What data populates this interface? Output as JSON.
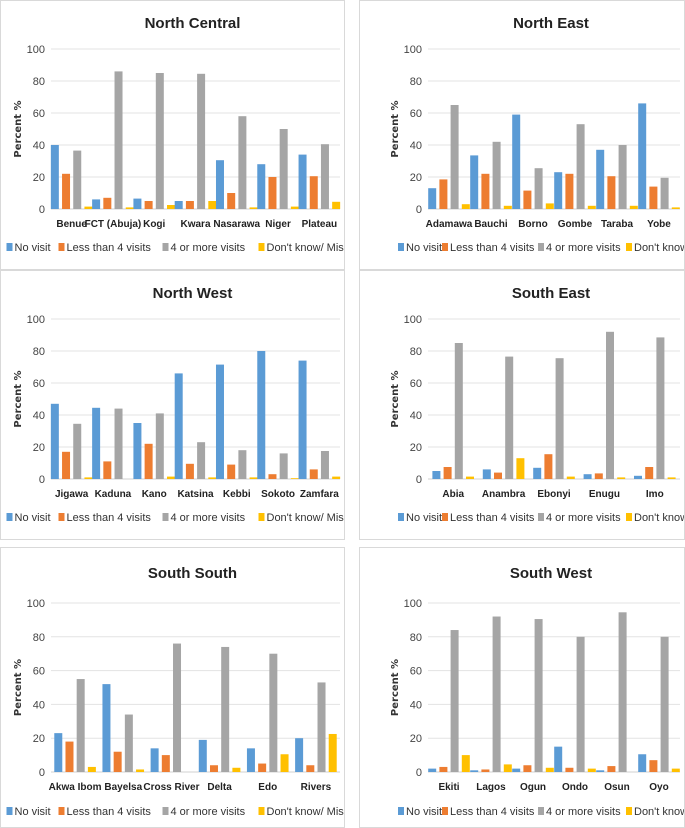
{
  "chart_data": [
    {
      "type": "bar",
      "title": "North Central",
      "xlabel": "",
      "ylabel": "Percent %",
      "ylim": [
        0,
        100
      ],
      "yticks": [
        0,
        20,
        40,
        60,
        80,
        100
      ],
      "grid": true,
      "legend_position": "bottom",
      "categories": [
        "Benue",
        "FCT (Abuja)",
        "Kogi",
        "Kwara",
        "Nasarawa",
        "Niger",
        "Plateau"
      ],
      "series": [
        {
          "name": "No visit",
          "color": "#5b9bd5",
          "values": [
            40,
            6,
            6.5,
            5,
            30.5,
            28,
            34
          ]
        },
        {
          "name": "Less than 4 visits",
          "color": "#ed7d31",
          "values": [
            22,
            7,
            5,
            5,
            10,
            20,
            20.5
          ]
        },
        {
          "name": "4 or more visits",
          "color": "#a5a5a5",
          "values": [
            36.5,
            86,
            85,
            84.5,
            58,
            50,
            40.5
          ]
        },
        {
          "name": "Don't know/ Missing",
          "color": "#ffc000",
          "values": [
            1.5,
            1,
            2.5,
            5,
            1,
            1.5,
            4.5
          ]
        }
      ]
    },
    {
      "type": "bar",
      "title": "North East",
      "xlabel": "",
      "ylabel": "Percent %",
      "ylim": [
        0,
        100
      ],
      "yticks": [
        0,
        20,
        40,
        60,
        80,
        100
      ],
      "grid": true,
      "legend_position": "bottom",
      "categories": [
        "Adamawa",
        "Bauchi",
        "Borno",
        "Gombe",
        "Taraba",
        "Yobe"
      ],
      "series": [
        {
          "name": "No visit",
          "color": "#5b9bd5",
          "values": [
            13,
            33.5,
            59,
            23,
            37,
            66
          ]
        },
        {
          "name": "Less than 4 visits",
          "color": "#ed7d31",
          "values": [
            18.5,
            22,
            11.5,
            22,
            20.5,
            14
          ]
        },
        {
          "name": "4 or more visits",
          "color": "#a5a5a5",
          "values": [
            65,
            42,
            25.5,
            53,
            40,
            19.5
          ]
        },
        {
          "name": "Don't know/ Missing",
          "color": "#ffc000",
          "values": [
            3,
            2,
            3.5,
            2,
            2,
            1
          ]
        }
      ]
    },
    {
      "type": "bar",
      "title": "North West",
      "xlabel": "",
      "ylabel": "Percent %",
      "ylim": [
        0,
        100
      ],
      "yticks": [
        0,
        20,
        40,
        60,
        80,
        100
      ],
      "grid": true,
      "legend_position": "bottom",
      "categories": [
        "Jigawa",
        "Kaduna",
        "Kano",
        "Katsina",
        "Kebbi",
        "Sokoto",
        "Zamfara"
      ],
      "series": [
        {
          "name": "No visit",
          "color": "#5b9bd5",
          "values": [
            47,
            44.5,
            35,
            66,
            71.5,
            80,
            74
          ]
        },
        {
          "name": "Less than 4 visits",
          "color": "#ed7d31",
          "values": [
            17,
            11,
            22,
            9.5,
            9,
            3,
            6
          ]
        },
        {
          "name": "4 or more visits",
          "color": "#a5a5a5",
          "values": [
            34.5,
            44,
            41,
            23,
            18,
            16,
            17.5
          ]
        },
        {
          "name": "Don't know/ Missing",
          "color": "#ffc000",
          "values": [
            1,
            0,
            1.5,
            1,
            1,
            0.5,
            1.5
          ]
        }
      ]
    },
    {
      "type": "bar",
      "title": "South East",
      "xlabel": "",
      "ylabel": "Percent %",
      "ylim": [
        0,
        100
      ],
      "yticks": [
        0,
        20,
        40,
        60,
        80,
        100
      ],
      "grid": true,
      "legend_position": "bottom",
      "categories": [
        "Abia",
        "Anambra",
        "Ebonyi",
        "Enugu",
        "Imo"
      ],
      "series": [
        {
          "name": "No visit",
          "color": "#5b9bd5",
          "values": [
            5,
            6,
            7,
            3,
            2
          ]
        },
        {
          "name": "Less than 4 visits",
          "color": "#ed7d31",
          "values": [
            7.5,
            4,
            15.5,
            3.5,
            7.5
          ]
        },
        {
          "name": "4 or more visits",
          "color": "#a5a5a5",
          "values": [
            85,
            76.5,
            75.5,
            92,
            88.5
          ]
        },
        {
          "name": "Don't know/ Missing",
          "color": "#ffc000",
          "values": [
            1.5,
            13,
            1.5,
            1,
            1
          ]
        }
      ]
    },
    {
      "type": "bar",
      "title": "South South",
      "xlabel": "",
      "ylabel": "Percent %",
      "ylim": [
        0,
        100
      ],
      "yticks": [
        0,
        20,
        40,
        60,
        80,
        100
      ],
      "grid": true,
      "legend_position": "bottom",
      "categories": [
        "Akwa Ibom",
        "Bayelsa",
        "Cross River",
        "Delta",
        "Edo",
        "Rivers"
      ],
      "series": [
        {
          "name": "No visit",
          "color": "#5b9bd5",
          "values": [
            23,
            52,
            14,
            19,
            14,
            20
          ]
        },
        {
          "name": "Less than 4 visits",
          "color": "#ed7d31",
          "values": [
            18,
            12,
            10,
            4,
            5,
            4
          ]
        },
        {
          "name": "4 or more visits",
          "color": "#a5a5a5",
          "values": [
            55,
            34,
            76,
            74,
            70,
            53
          ]
        },
        {
          "name": "Don't know/ Missing",
          "color": "#ffc000",
          "values": [
            3,
            1.5,
            0,
            2.5,
            10.5,
            22.5
          ]
        }
      ]
    },
    {
      "type": "bar",
      "title": "South West",
      "xlabel": "",
      "ylabel": "Percent %",
      "ylim": [
        0,
        100
      ],
      "yticks": [
        0,
        20,
        40,
        60,
        80,
        100
      ],
      "grid": true,
      "legend_position": "bottom",
      "categories": [
        "Ekiti",
        "Lagos",
        "Ogun",
        "Ondo",
        "Osun",
        "Oyo"
      ],
      "series": [
        {
          "name": "No visit",
          "color": "#5b9bd5",
          "values": [
            2,
            1,
            2,
            15,
            1,
            10.5
          ]
        },
        {
          "name": "Less than 4 visits",
          "color": "#ed7d31",
          "values": [
            3,
            1.5,
            4,
            2.5,
            3.5,
            7
          ]
        },
        {
          "name": "4 or more visits",
          "color": "#a5a5a5",
          "values": [
            84,
            92,
            90.5,
            80,
            94.5,
            80
          ]
        },
        {
          "name": "Don't know/ Missing",
          "color": "#ffc000",
          "values": [
            10,
            4.5,
            2.5,
            2,
            0,
            2
          ]
        }
      ]
    }
  ]
}
